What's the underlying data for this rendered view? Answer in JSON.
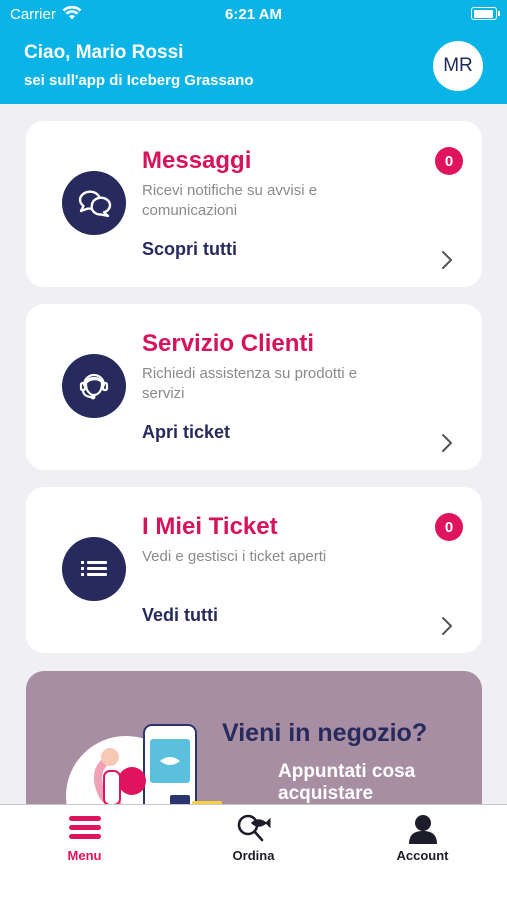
{
  "status_bar": {
    "carrier": "Carrier",
    "time": "6:21 AM"
  },
  "header": {
    "greeting": "Ciao, Mario Rossi",
    "subtitle": "sei sull'app di Iceberg Grassano",
    "avatar_initials": "MR"
  },
  "cards": [
    {
      "title": "Messaggi",
      "description": "Ricevi notifiche su avvisi e comunicazioni",
      "action": "Scopri tutti",
      "badge": "0",
      "icon": "chat-bubbles-icon"
    },
    {
      "title": "Servizio Clienti",
      "description": "Richiedi assistenza su prodotti e servizi",
      "action": "Apri ticket",
      "icon": "headset-agent-icon"
    },
    {
      "title": "I Miei Ticket",
      "description": "Vedi e gestisci i ticket aperti",
      "action": "Vedi tutti",
      "badge": "0",
      "icon": "list-icon"
    }
  ],
  "promo": {
    "title": "Vieni in negozio?",
    "subtitle": "Appuntati cosa acquistare"
  },
  "tabs": [
    {
      "label": "Menu",
      "icon": "menu-icon",
      "active": true
    },
    {
      "label": "Ordina",
      "icon": "search-fish-icon",
      "active": false
    },
    {
      "label": "Account",
      "icon": "user-icon",
      "active": false
    }
  ],
  "colors": {
    "header": "#0ab4e6",
    "accent": "#d6135a",
    "navy": "#262a5c",
    "promo_bg": "#a88ea3"
  }
}
